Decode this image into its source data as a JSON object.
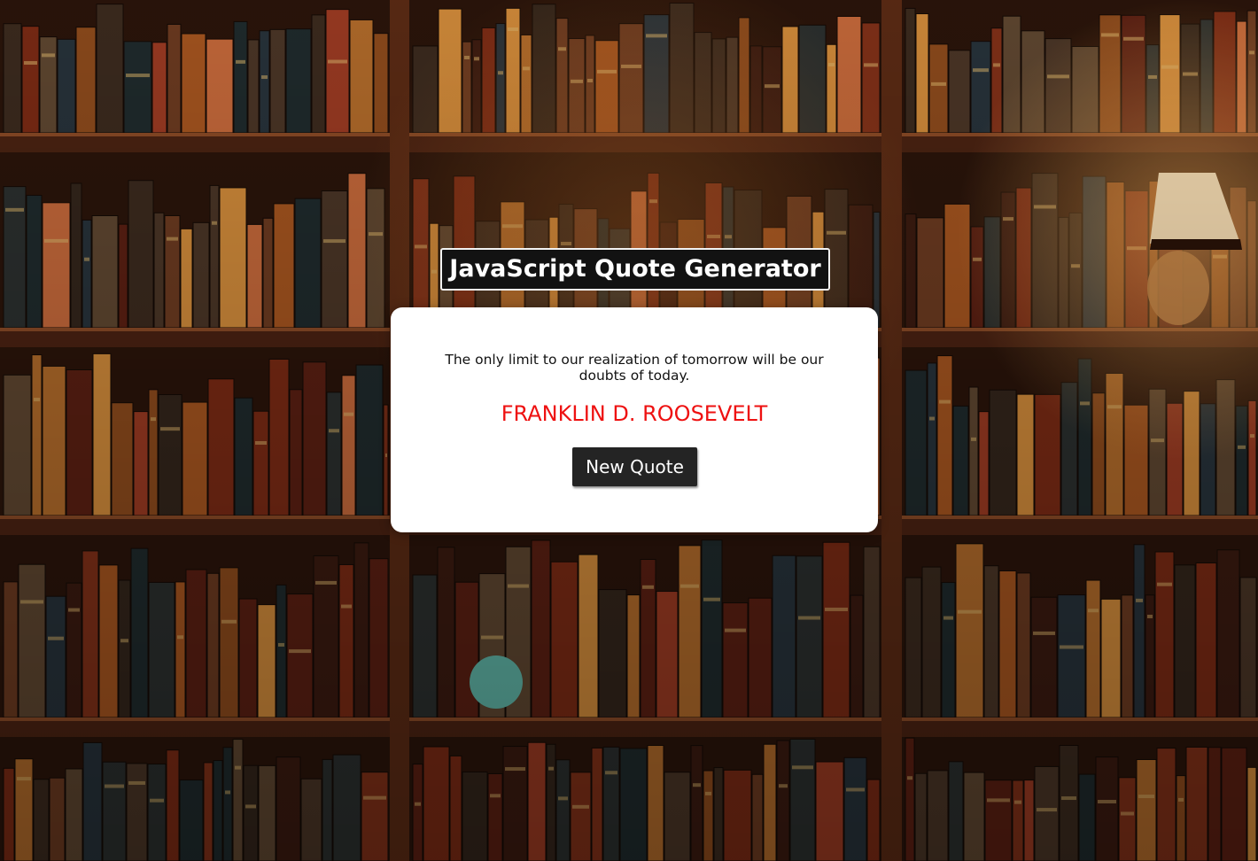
{
  "header": {
    "title": "JavaScript Quote Generator"
  },
  "quote": {
    "text": "The only limit to our realization of tomorrow will be our doubts of today.",
    "author": "FRANKLIN D. ROOSEVELT"
  },
  "actions": {
    "new_quote_label": "New Quote"
  },
  "colors": {
    "author_text": "#ee1111",
    "button_bg": "#242424",
    "card_bg": "#ffffff",
    "title_bg": "#121212",
    "background_wood": "#3a1c0c"
  },
  "background": {
    "subject": "bookshelf-photo"
  }
}
